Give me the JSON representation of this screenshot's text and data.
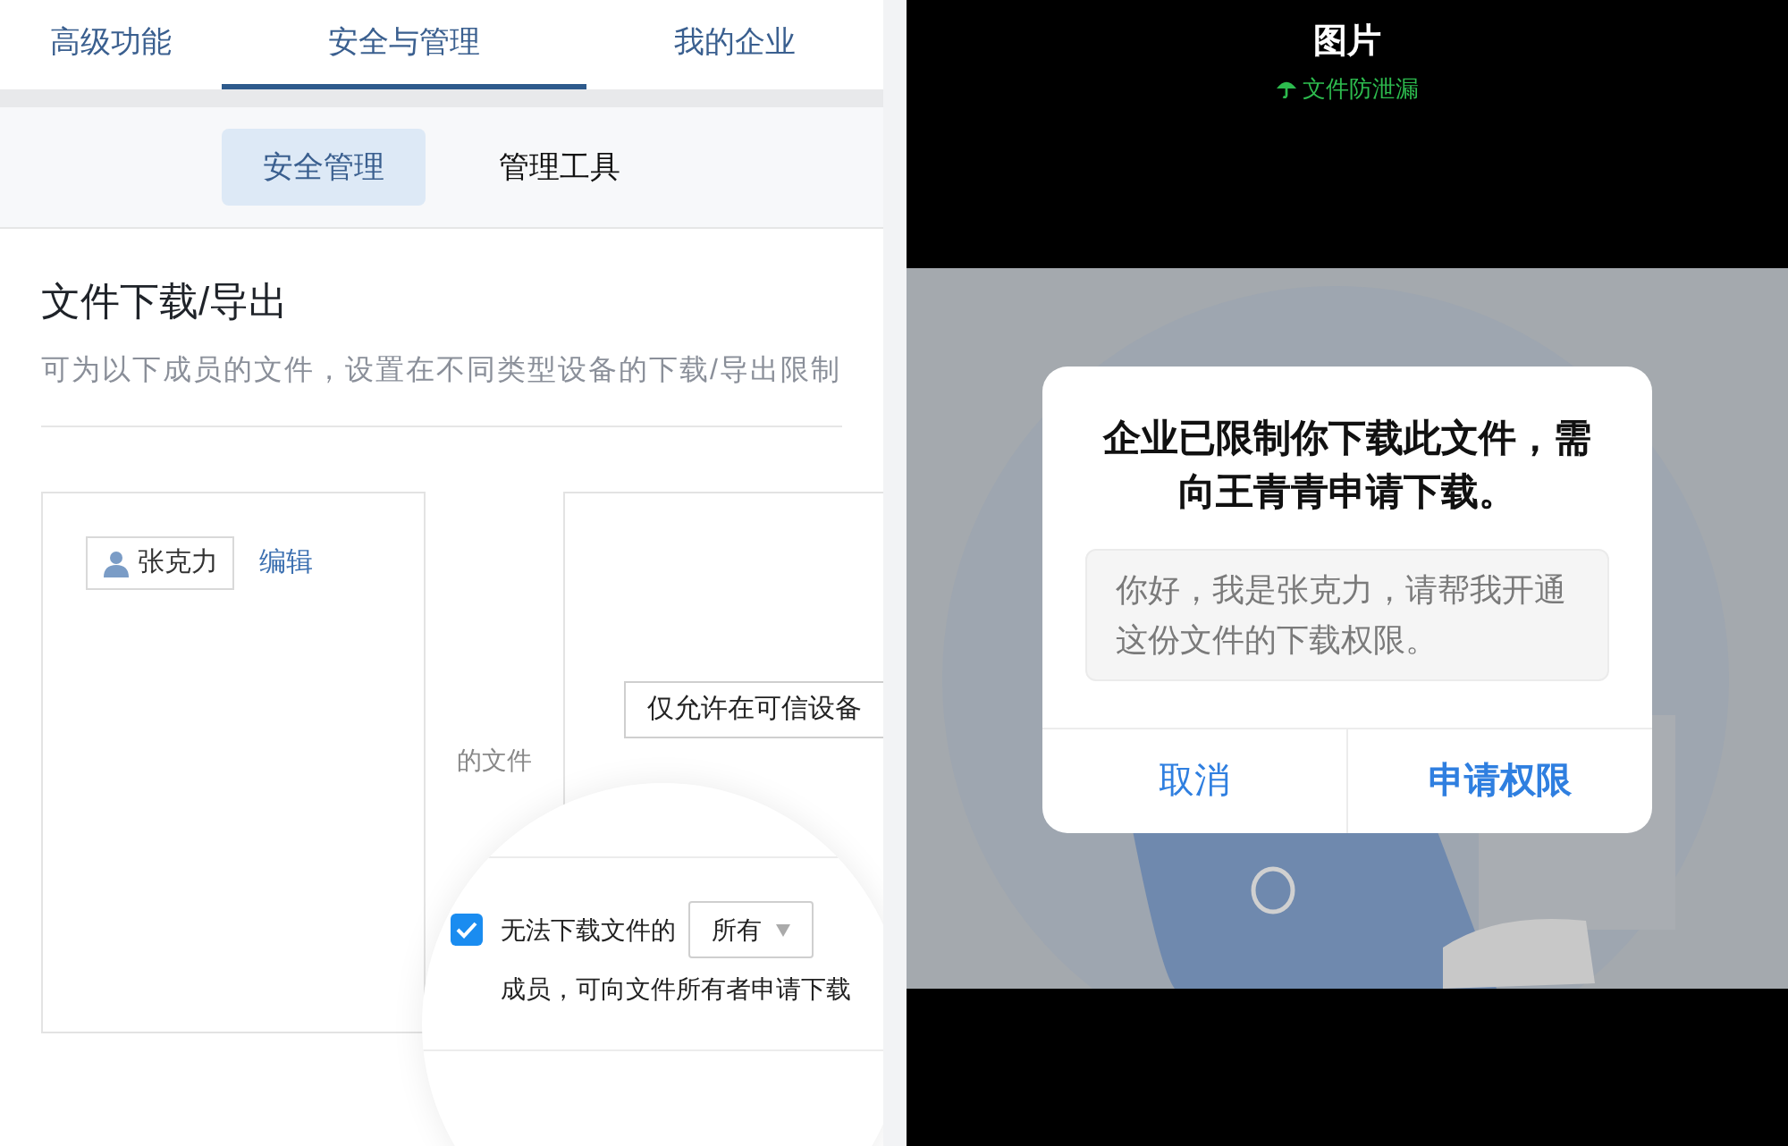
{
  "left_panel": {
    "tabs": [
      {
        "label": "高级功能",
        "selected": false
      },
      {
        "label": "安全与管理",
        "selected": true
      },
      {
        "label": "我的企业",
        "selected": false
      }
    ],
    "subtabs": [
      {
        "label": "安全管理",
        "selected": true
      },
      {
        "label": "管理工具",
        "selected": false
      }
    ],
    "section": {
      "title": "文件下载/导出",
      "description": "可为以下成员的文件，设置在不同类型设备的下载/导出限制"
    },
    "member": {
      "name": "张克力",
      "edit": "编辑"
    },
    "file_label": "的文件",
    "device_select": {
      "value": "仅允许在可信设备"
    },
    "magnifier": {
      "checkbox": {
        "checked": true,
        "label": "无法下载文件的"
      },
      "scope_select": {
        "value": "所有"
      },
      "continuation": "成员，可向文件所有者申请下载"
    }
  },
  "right_panel": {
    "title": "图片",
    "protection_badge": "文件防泄漏",
    "dialog": {
      "message": "企业已限制你下载此文件，需向王青青申请下载。",
      "request_text": "你好，我是张克力，请帮我开通这份文件的下载权限。",
      "buttons": [
        {
          "label": "取消",
          "primary": false
        },
        {
          "label": "申请权限",
          "primary": true
        }
      ]
    }
  }
}
